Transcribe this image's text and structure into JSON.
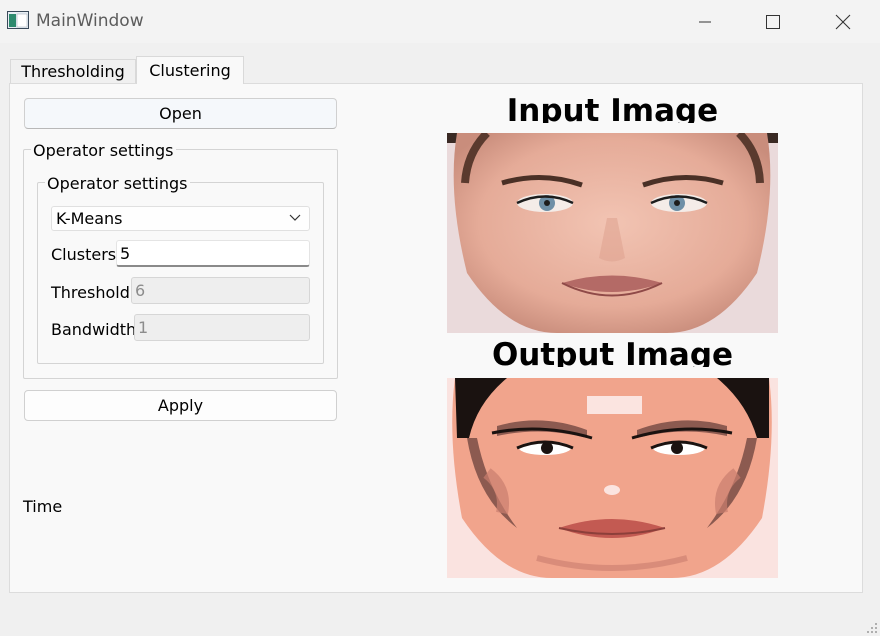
{
  "window": {
    "title": "MainWindow",
    "icon": "app-window-icon"
  },
  "tabs": [
    {
      "label": "Thresholding",
      "active": false
    },
    {
      "label": "Clustering",
      "active": true
    }
  ],
  "left_panel": {
    "open_button": "Open",
    "outer_group_title": "Operator settings",
    "inner_group_title": "Operator settings",
    "operator_combo": {
      "selected": "K-Means"
    },
    "clusters": {
      "label": "Clusters",
      "value": "5"
    },
    "threshold": {
      "label": "Threshold",
      "value": "6",
      "enabled": false
    },
    "bandwidth": {
      "label": "Bandwidth",
      "value": "1",
      "enabled": false
    },
    "apply_button": "Apply",
    "time_label": "Time"
  },
  "right_panel": {
    "input_title": "Input Image",
    "output_title": "Output Image"
  },
  "colors": {
    "accent": "#0078d4",
    "panel": "#f9f9f9",
    "window": "#f0f0f0"
  }
}
